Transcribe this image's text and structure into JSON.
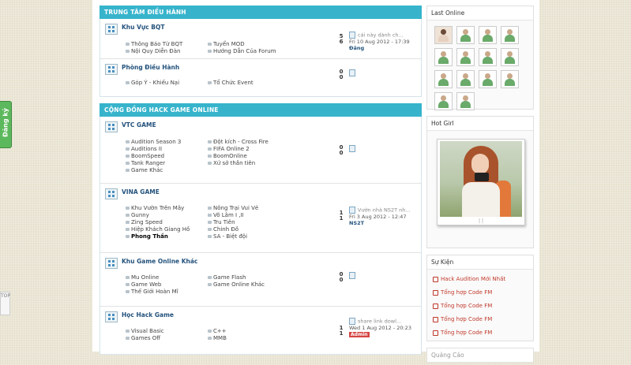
{
  "side_tab": {
    "label": "Đăng ký"
  },
  "mini_tool": {
    "label": "TOP"
  },
  "categories": [
    {
      "title": "TRUNG TÂM ĐIỀU HÀNH",
      "forums": [
        {
          "name": "Khu Vực BQT",
          "subs": [
            "Thông Báo Từ BQT",
            "Tuyển MOD",
            "Nội Quy Diễn Đàn",
            "Hướng Dẫn Của Forum"
          ],
          "topics": "5",
          "posts": "6",
          "last": {
            "title": "cái này dành ch...",
            "time": "Fri 10 Aug 2012 - 17:39",
            "user": "Đăng"
          }
        },
        {
          "name": "Phòng Điều Hành",
          "subs": [
            "Góp Ý - Khiếu Nại",
            "Tổ Chức Event"
          ],
          "topics": "0",
          "posts": "0",
          "last": {
            "title": "",
            "time": "",
            "user": ""
          }
        }
      ]
    },
    {
      "title": "CỘNG ĐỒNG HACK GAME ONLINE",
      "forums": [
        {
          "name": "VTC GAME",
          "subs": [
            "Audition Season 3",
            "Đột kích - Cross Fire",
            "Auditions II",
            "FIFA Online 2",
            "BoomSpeed",
            "BoomOnline",
            "Tank Ranger",
            "Xứ sở thần tiên",
            "Game Khác"
          ],
          "topics": "0",
          "posts": "0",
          "last": {
            "title": "",
            "time": "",
            "user": ""
          }
        },
        {
          "name": "VINA GAME",
          "subs": [
            "Khu Vườn Trên Mây",
            "Nông Trại Vui Vẻ",
            "Gunny",
            "Võ Lâm I ,II",
            "Zing Speed",
            "Tru Tiên",
            "Hiệp Khách Giang Hồ",
            "Chinh Đồ",
            "Phong Thần",
            "SA - Biệt đội"
          ],
          "topics": "1",
          "posts": "1",
          "last": {
            "title": "Vườn nhà NS2T nh...",
            "time": "Fri 3 Aug 2012 - 12:47",
            "user": "NS2T"
          }
        },
        {
          "name": "Khu Game Online Khác",
          "subs": [
            "Mu Online",
            "Game Flash",
            "Game Web",
            "Game Online Khác",
            "Thế Giới Hoàn Mĩ"
          ],
          "topics": "0",
          "posts": "0",
          "last": {
            "title": "",
            "time": "",
            "user": ""
          }
        },
        {
          "name": "Học Hack Game",
          "subs": [
            "Visual Basic",
            "C++",
            "Games Off",
            "MMB"
          ],
          "topics": "1",
          "posts": "1",
          "last": {
            "title": "share link dowl...",
            "time": "Wed 1 Aug 2012 - 20:23",
            "user": "Admin"
          }
        }
      ]
    }
  ],
  "sidebar": {
    "last_online": {
      "title": "Last Online"
    },
    "hot_girl": {
      "title": "Hot Girl",
      "caption": "| |"
    },
    "events": {
      "title": "Sự Kiện",
      "items": [
        "Hack Audition Mới Nhất",
        "Tổng hợp Code FM",
        "Tổng hợp Code FM",
        "Tổng hợp Code FM",
        "Tổng hợp Code FM"
      ]
    },
    "next_box": {
      "title": "Quảng Cáo"
    }
  }
}
